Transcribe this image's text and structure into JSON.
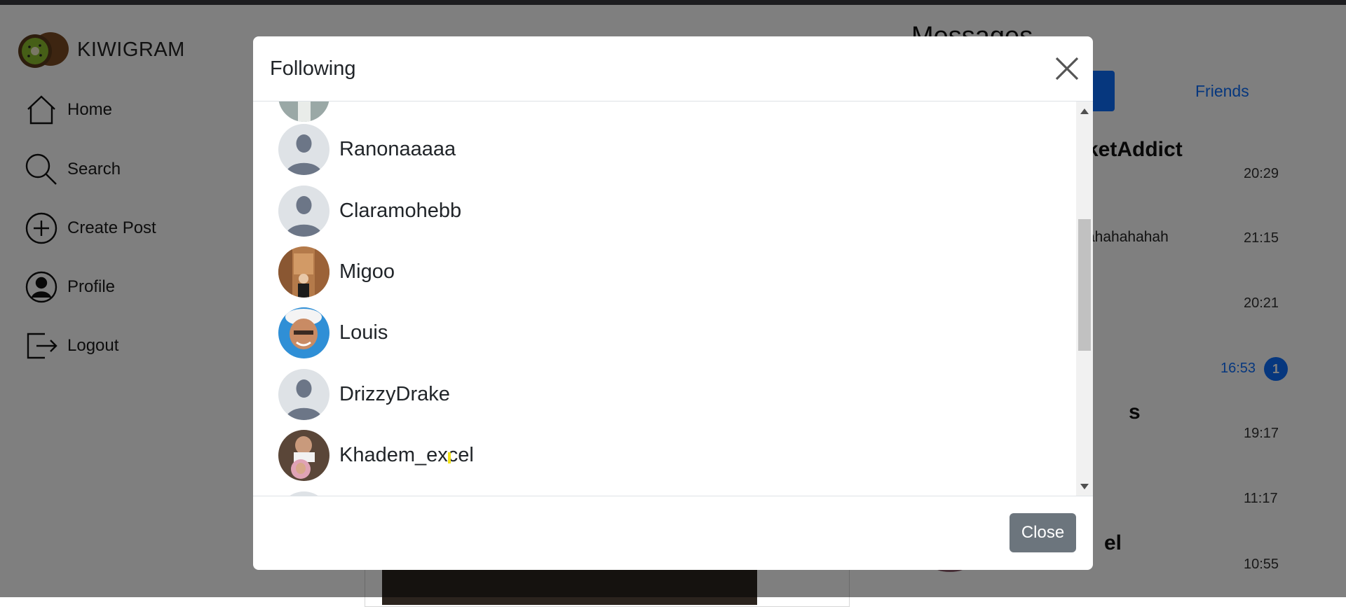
{
  "app": {
    "brand": "KIWIGRAM",
    "nav": {
      "home": "Home",
      "search": "Search",
      "create_post": "Create Post",
      "profile": "Profile",
      "logout": "Logout"
    }
  },
  "messages_panel": {
    "heading": "Messages",
    "friends_tab": "Friends",
    "conversations": [
      {
        "name": "ketAddict",
        "snippet": "",
        "time": "20:29"
      },
      {
        "name": "",
        "snippet": "ahahahahah",
        "time": "21:15"
      },
      {
        "name": "",
        "snippet": "",
        "time": "20:21"
      },
      {
        "name": "",
        "snippet": "",
        "time": "16:53",
        "unread": "1"
      },
      {
        "name": "s",
        "snippet": "",
        "time": "19:17"
      },
      {
        "name": "",
        "snippet": "",
        "time": "11:17"
      },
      {
        "name": "el",
        "snippet": "",
        "time": "10:55"
      }
    ]
  },
  "modal": {
    "title": "Following",
    "users": [
      {
        "name": "Ranonaaaaa",
        "avatar": "default-avatar-icon"
      },
      {
        "name": "Claramohebb",
        "avatar": "default-avatar-icon"
      },
      {
        "name": "Migoo",
        "avatar": "photo"
      },
      {
        "name": "Louis",
        "avatar": "photo"
      },
      {
        "name": "DrizzyDrake",
        "avatar": "default-avatar-icon"
      },
      {
        "name": "Khadem_excel",
        "avatar": "photo"
      }
    ],
    "close_button": "Close"
  },
  "colors": {
    "primary": "#0d6efd",
    "secondary_button": "#6c757d",
    "backdrop": "rgba(0,0,0,0.5)"
  }
}
